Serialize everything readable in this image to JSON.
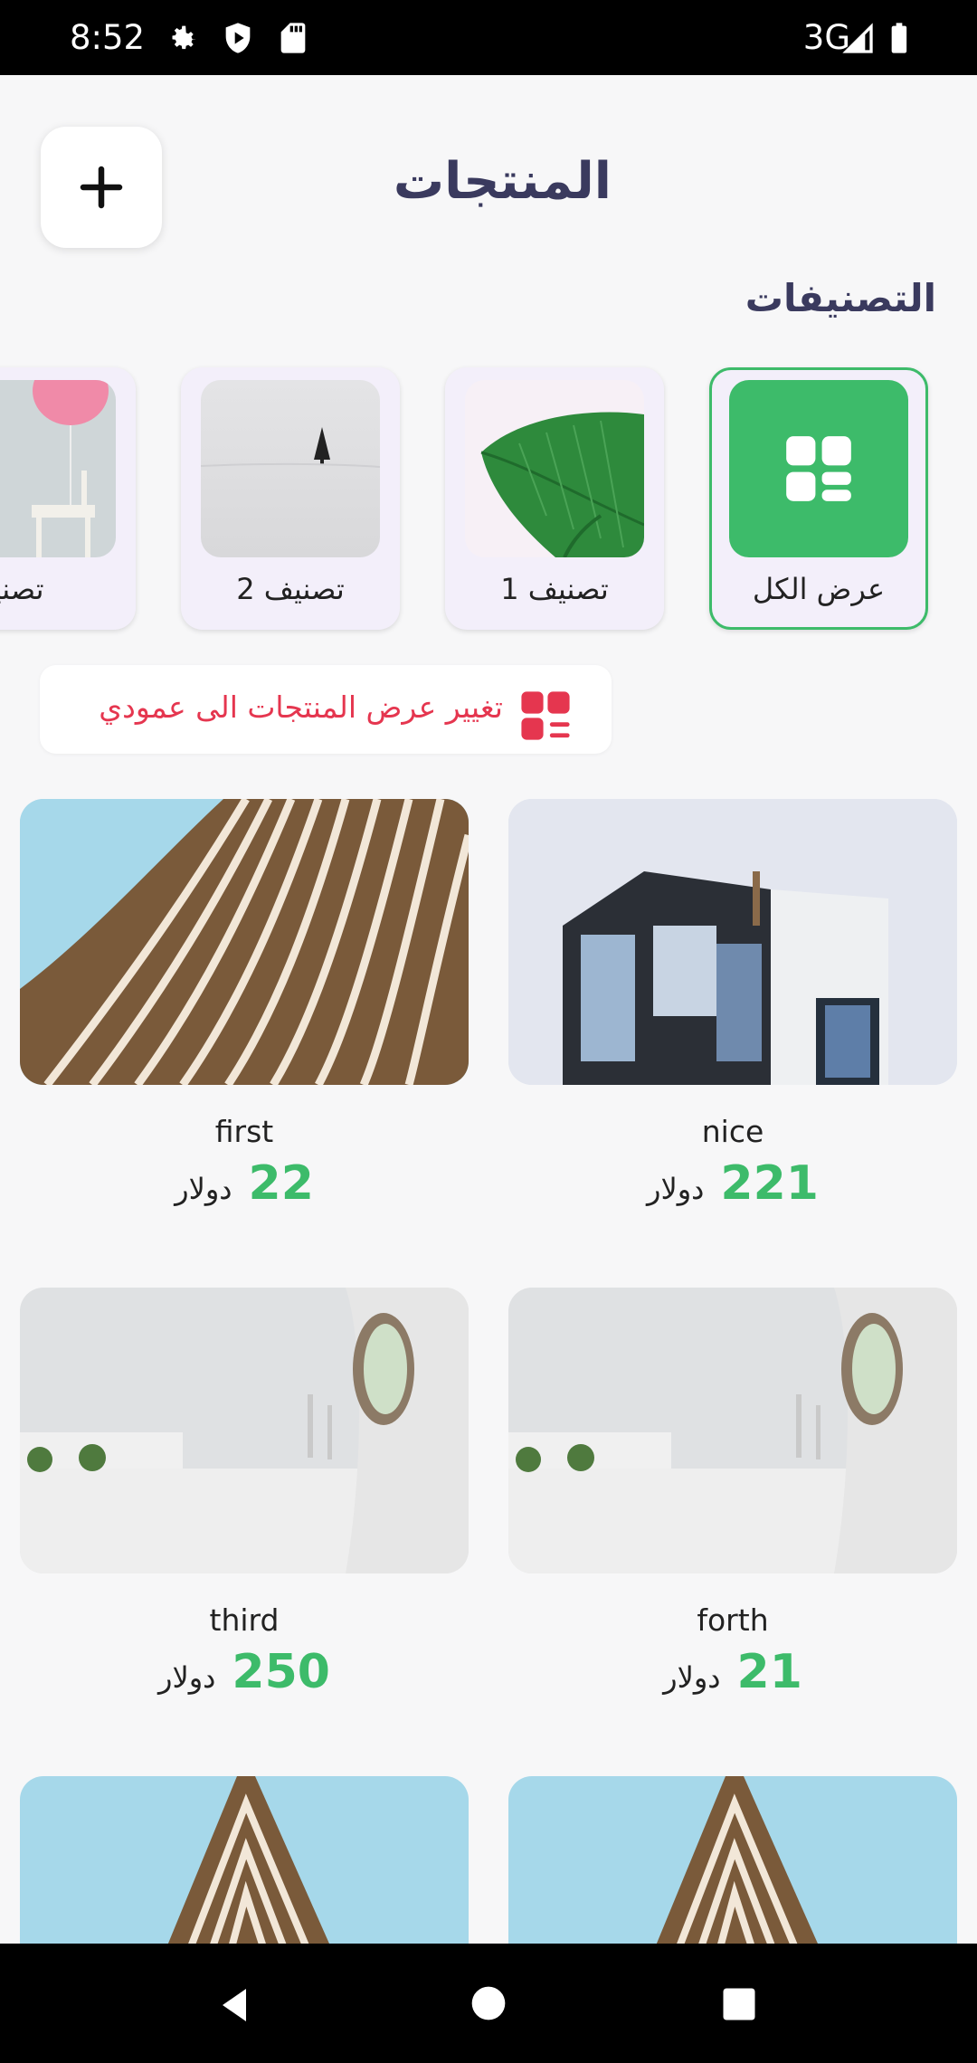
{
  "status_bar": {
    "time": "8:52",
    "network": "3G",
    "icons": [
      "gear-icon",
      "shield-icon",
      "sd-card-icon",
      "signal-icon",
      "battery-icon"
    ]
  },
  "header": {
    "title": "المنتجات",
    "add_icon": "plus-icon"
  },
  "categories": {
    "title": "التصنيفات",
    "items": [
      {
        "label": "عرض الكل",
        "icon": "grid-icon",
        "active": true
      },
      {
        "label": "تصنيف 1",
        "image": "leaf"
      },
      {
        "label": "تصنيف 2",
        "image": "tree-snow"
      },
      {
        "label": "تصنيف",
        "image": "balloon-chair"
      }
    ]
  },
  "view_toggle": {
    "label": "تغيير عرض المنتجات الى عمودي",
    "icon": "grid-list-icon"
  },
  "products": [
    {
      "name": "nice",
      "price": "221",
      "currency": "دولار",
      "image": "dark-building"
    },
    {
      "name": "first",
      "price": "22",
      "currency": "دولار",
      "image": "curved-building"
    },
    {
      "name": "forth",
      "price": "21",
      "currency": "دولار",
      "image": "white-building"
    },
    {
      "name": "third",
      "price": "250",
      "currency": "دولار",
      "image": "white-building"
    },
    {
      "name": "",
      "price": "",
      "currency": "",
      "image": "curved-building"
    },
    {
      "name": "",
      "price": "",
      "currency": "",
      "image": "curved-building"
    }
  ],
  "nav_bar": {
    "icons": [
      "back-icon",
      "home-icon",
      "recents-icon"
    ]
  },
  "colors": {
    "accent": "#3dbb6a",
    "title": "#3a3a5e",
    "toggle": "#e5364f"
  }
}
